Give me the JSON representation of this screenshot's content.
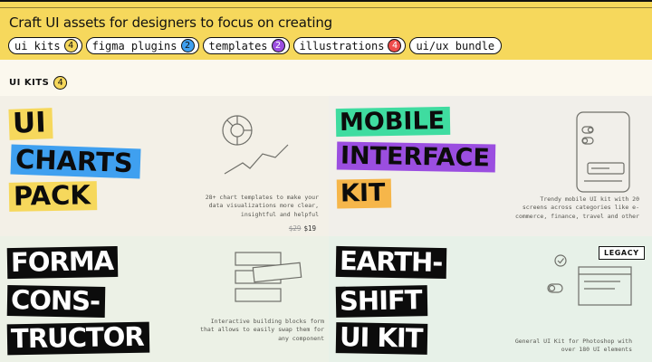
{
  "header": {
    "title": "Craft UI assets for designers to focus on creating",
    "chips": [
      {
        "label": "ui kits",
        "count": "4",
        "color": "#f6d85c"
      },
      {
        "label": "figma plugins",
        "count": "2",
        "color": "#3fa0f0"
      },
      {
        "label": "templates",
        "count": "2",
        "color": "#9b4ee0"
      },
      {
        "label": "illustrations",
        "count": "4",
        "color": "#ee4b4b"
      },
      {
        "label": "ui/ux bundle",
        "count": "",
        "color": ""
      }
    ]
  },
  "section": {
    "label": "UI KITS",
    "count": "4"
  },
  "products": [
    {
      "title_lines": [
        "UI",
        "CHARTS",
        "PACK"
      ],
      "highlight_colors": [
        "#f6d85c",
        "#3fa0f0",
        "#f6d85c"
      ],
      "icon": "chart-illustration-icon",
      "description": "28+ chart templates to make your data visualizations more clear, insightful and helpful",
      "old_price": "$29",
      "price": "$19"
    },
    {
      "title_lines": [
        "MOBILE",
        "INTERFACE",
        "KIT"
      ],
      "highlight_colors": [
        "#3fdca0",
        "#9b4ee0",
        "#f6b64a"
      ],
      "icon": "phone-illustration-icon",
      "description": "Trendy mobile UI kit with 20 screens across categories like e-commerce, finance, travel and other",
      "old_price": "",
      "price": ""
    },
    {
      "title_lines": [
        "FORMA",
        "CONS-",
        "TRUCTOR"
      ],
      "highlight_colors": [
        "#0c0c0c",
        "#0c0c0c",
        "#0c0c0c"
      ],
      "icon": "blocks-illustration-icon",
      "description": "Interactive building blocks form that allows to easily swap them for any component",
      "old_price": "",
      "price": ""
    },
    {
      "title_lines": [
        "EARTH-",
        "SHIFT",
        "UI KIT"
      ],
      "highlight_colors": [
        "#0c0c0c",
        "#0c0c0c",
        "#0c0c0c"
      ],
      "icon": "ui-elements-illustration-icon",
      "description": "General UI Kit for Photoshop with over 180 UI elements",
      "badge": "LEGACY",
      "old_price": "",
      "price": ""
    }
  ]
}
